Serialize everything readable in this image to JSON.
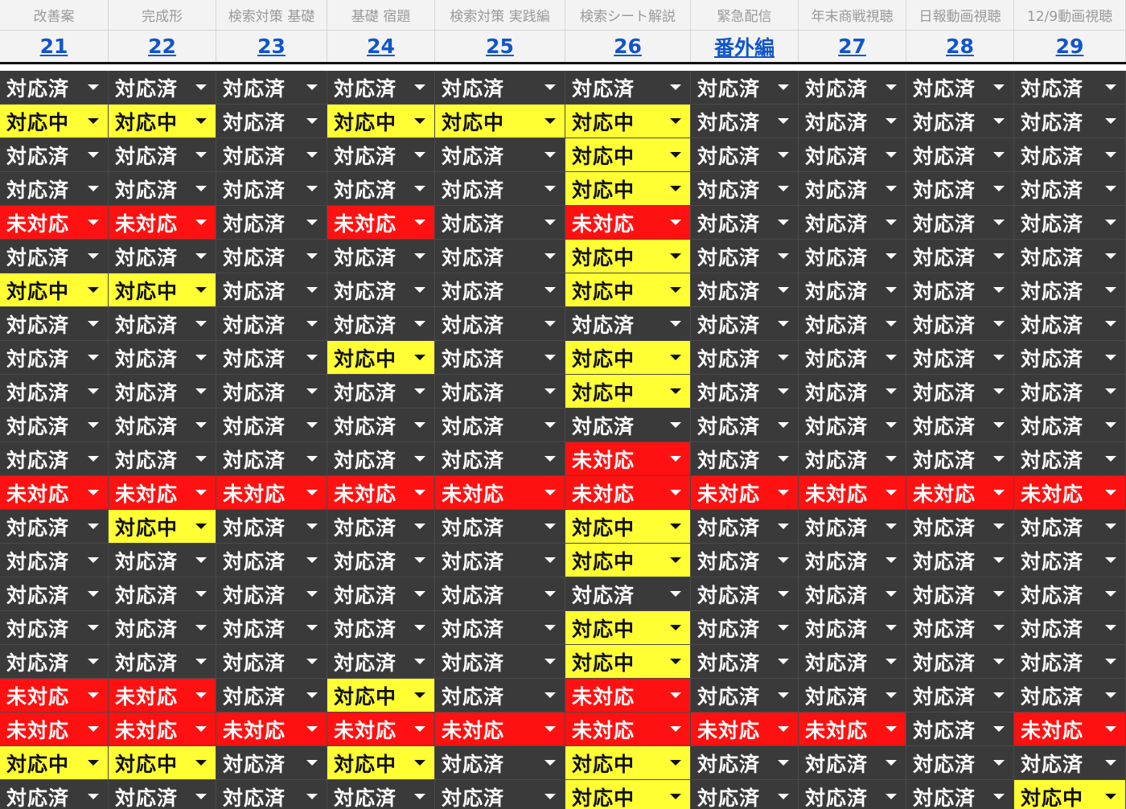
{
  "columns": [
    {
      "category": "改善案",
      "episode": "21"
    },
    {
      "category": "完成形",
      "episode": "22"
    },
    {
      "category": "検索対策 基礎",
      "episode": "23"
    },
    {
      "category": "基礎 宿題",
      "episode": "24"
    },
    {
      "category": "検索対策 実践編",
      "episode": "25"
    },
    {
      "category": "検索シート解説",
      "episode": "26"
    },
    {
      "category": "緊急配信",
      "episode": "番外編"
    },
    {
      "category": "年末商戦視聴",
      "episode": "27"
    },
    {
      "category": "日報動画視聴",
      "episode": "28"
    },
    {
      "category": "12/9動画視聴",
      "episode": "29"
    }
  ],
  "status_labels": {
    "done": "対応済",
    "prog": "対応中",
    "todo": "未対応"
  },
  "status_colors": {
    "done": "#3a3a3a",
    "prog": "#ffff33",
    "todo": "#ff1111"
  },
  "rows": [
    [
      "対応済",
      "対応済",
      "対応済",
      "対応済",
      "対応済",
      "対応済",
      "対応済",
      "対応済",
      "対応済",
      "対応済"
    ],
    [
      "対応中",
      "対応中",
      "対応済",
      "対応中",
      "対応中",
      "対応中",
      "対応済",
      "対応済",
      "対応済",
      "対応済"
    ],
    [
      "対応済",
      "対応済",
      "対応済",
      "対応済",
      "対応済",
      "対応中",
      "対応済",
      "対応済",
      "対応済",
      "対応済"
    ],
    [
      "対応済",
      "対応済",
      "対応済",
      "対応済",
      "対応済",
      "対応中",
      "対応済",
      "対応済",
      "対応済",
      "対応済"
    ],
    [
      "未対応",
      "未対応",
      "対応済",
      "未対応",
      "対応済",
      "未対応",
      "対応済",
      "対応済",
      "対応済",
      "対応済"
    ],
    [
      "対応済",
      "対応済",
      "対応済",
      "対応済",
      "対応済",
      "対応中",
      "対応済",
      "対応済",
      "対応済",
      "対応済"
    ],
    [
      "対応中",
      "対応中",
      "対応済",
      "対応済",
      "対応済",
      "対応中",
      "対応済",
      "対応済",
      "対応済",
      "対応済"
    ],
    [
      "対応済",
      "対応済",
      "対応済",
      "対応済",
      "対応済",
      "対応済",
      "対応済",
      "対応済",
      "対応済",
      "対応済"
    ],
    [
      "対応済",
      "対応済",
      "対応済",
      "対応中",
      "対応済",
      "対応中",
      "対応済",
      "対応済",
      "対応済",
      "対応済"
    ],
    [
      "対応済",
      "対応済",
      "対応済",
      "対応済",
      "対応済",
      "対応中",
      "対応済",
      "対応済",
      "対応済",
      "対応済"
    ],
    [
      "対応済",
      "対応済",
      "対応済",
      "対応済",
      "対応済",
      "対応済",
      "対応済",
      "対応済",
      "対応済",
      "対応済"
    ],
    [
      "対応済",
      "対応済",
      "対応済",
      "対応済",
      "対応済",
      "未対応",
      "対応済",
      "対応済",
      "対応済",
      "対応済"
    ],
    [
      "未対応",
      "未対応",
      "未対応",
      "未対応",
      "未対応",
      "未対応",
      "未対応",
      "未対応",
      "未対応",
      "未対応"
    ],
    [
      "対応済",
      "対応中",
      "対応済",
      "対応済",
      "対応済",
      "対応中",
      "対応済",
      "対応済",
      "対応済",
      "対応済"
    ],
    [
      "対応済",
      "対応済",
      "対応済",
      "対応済",
      "対応済",
      "対応中",
      "対応済",
      "対応済",
      "対応済",
      "対応済"
    ],
    [
      "対応済",
      "対応済",
      "対応済",
      "対応済",
      "対応済",
      "対応済",
      "対応済",
      "対応済",
      "対応済",
      "対応済"
    ],
    [
      "対応済",
      "対応済",
      "対応済",
      "対応済",
      "対応済",
      "対応中",
      "対応済",
      "対応済",
      "対応済",
      "対応済"
    ],
    [
      "対応済",
      "対応済",
      "対応済",
      "対応済",
      "対応済",
      "対応中",
      "対応済",
      "対応済",
      "対応済",
      "対応済"
    ],
    [
      "未対応",
      "未対応",
      "対応済",
      "対応中",
      "対応済",
      "未対応",
      "対応済",
      "対応済",
      "対応済",
      "対応済"
    ],
    [
      "未対応",
      "未対応",
      "未対応",
      "未対応",
      "未対応",
      "未対応",
      "未対応",
      "未対応",
      "対応済",
      "未対応"
    ],
    [
      "対応中",
      "対応中",
      "対応済",
      "対応中",
      "対応済",
      "対応中",
      "対応済",
      "対応済",
      "対応済",
      "対応済"
    ],
    [
      "対応済",
      "対応済",
      "対応済",
      "対応済",
      "対応済",
      "対応中",
      "対応済",
      "対応済",
      "対応済",
      "対応中"
    ]
  ]
}
